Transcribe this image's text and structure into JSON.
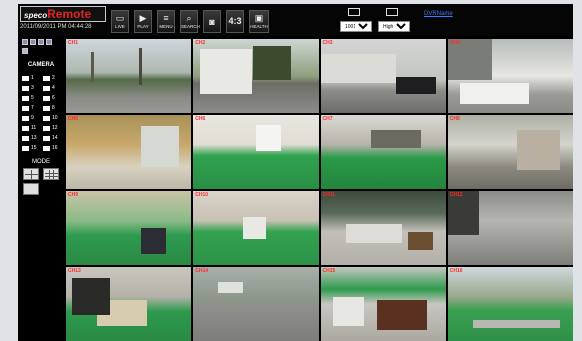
{
  "header": {
    "logo_brand": "speco",
    "logo_product": "Remote",
    "datetime": "2011/09/2011 PM 04:44:28",
    "buttons": [
      {
        "id": "live",
        "label": "LIVE",
        "icon": "monitor-icon"
      },
      {
        "id": "play",
        "label": "PLAY",
        "icon": "play-icon"
      },
      {
        "id": "menu",
        "label": "MENU",
        "icon": "menu-icon"
      },
      {
        "id": "search",
        "label": "SEARCH",
        "icon": "search-icon"
      },
      {
        "id": "capture",
        "label": "",
        "icon": "camera-icon"
      },
      {
        "id": "ratio",
        "label": "4:3",
        "icon": ""
      },
      {
        "id": "health",
        "label": "HEALTH",
        "icon": "health-icon"
      }
    ],
    "stream_select": {
      "value": "1001"
    },
    "quality_select": {
      "value": "High"
    },
    "dvr_link": "DVRName"
  },
  "sidebar": {
    "camera_title": "CAMERA",
    "cameras": [
      "1",
      "2",
      "3",
      "4",
      "5",
      "6",
      "7",
      "8",
      "9",
      "10",
      "11",
      "12",
      "13",
      "14",
      "15",
      "16"
    ],
    "mode_title": "MODE"
  },
  "tiles": [
    "CH1",
    "CH2",
    "CH3",
    "CH4",
    "CH5",
    "CH6",
    "CH7",
    "CH8",
    "CH9",
    "CH10",
    "CH11",
    "CH12",
    "CH13",
    "CH14",
    "CH15",
    "CH16"
  ],
  "colors": {
    "label": "#ff2a2a",
    "link": "#3b7bff",
    "grass": "#2e9a4a",
    "background": "#000000"
  }
}
